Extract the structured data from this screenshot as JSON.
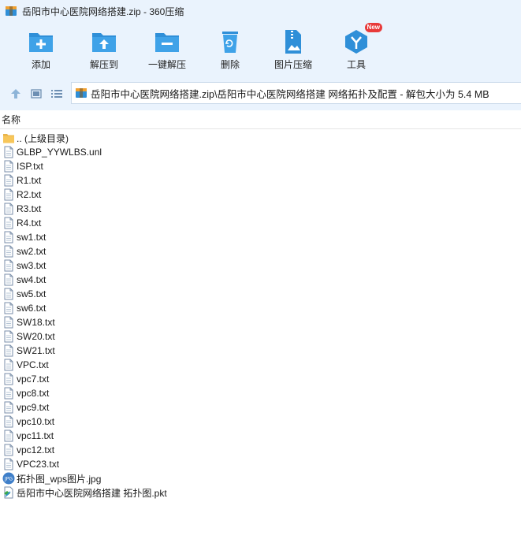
{
  "window": {
    "title": "岳阳市中心医院网络搭建.zip - 360压缩"
  },
  "toolbar": {
    "add_label": "添加",
    "extract_to_label": "解压到",
    "one_click_extract_label": "一键解压",
    "delete_label": "删除",
    "image_compress_label": "图片压缩",
    "tools_label": "工具",
    "tools_badge": "New"
  },
  "address": {
    "path": "岳阳市中心医院网络搭建.zip\\岳阳市中心医院网络搭建 网络拓扑及配置 - 解包大小为 5.4 MB"
  },
  "columns": {
    "name": "名称"
  },
  "files": [
    {
      "name": ".. (上级目录)",
      "type": "folder"
    },
    {
      "name": "GLBP_YYWLBS.unl",
      "type": "doc"
    },
    {
      "name": "ISP.txt",
      "type": "doc"
    },
    {
      "name": "R1.txt",
      "type": "doc"
    },
    {
      "name": "R2.txt",
      "type": "doc"
    },
    {
      "name": "R3.txt",
      "type": "doc"
    },
    {
      "name": "R4.txt",
      "type": "doc"
    },
    {
      "name": "sw1.txt",
      "type": "doc"
    },
    {
      "name": "sw2.txt",
      "type": "doc"
    },
    {
      "name": "sw3.txt",
      "type": "doc"
    },
    {
      "name": "sw4.txt",
      "type": "doc"
    },
    {
      "name": "sw5.txt",
      "type": "doc"
    },
    {
      "name": "sw6.txt",
      "type": "doc"
    },
    {
      "name": "SW18.txt",
      "type": "doc"
    },
    {
      "name": "SW20.txt",
      "type": "doc"
    },
    {
      "name": "SW21.txt",
      "type": "doc"
    },
    {
      "name": "VPC.txt",
      "type": "doc"
    },
    {
      "name": "vpc7.txt",
      "type": "doc"
    },
    {
      "name": "vpc8.txt",
      "type": "doc"
    },
    {
      "name": "vpc9.txt",
      "type": "doc"
    },
    {
      "name": "vpc10.txt",
      "type": "doc"
    },
    {
      "name": "vpc11.txt",
      "type": "doc"
    },
    {
      "name": "vpc12.txt",
      "type": "doc"
    },
    {
      "name": "VPC23.txt",
      "type": "doc"
    },
    {
      "name": "拓扑图_wps图片.jpg",
      "type": "jpg"
    },
    {
      "name": "岳阳市中心医院网络搭建 拓扑图.pkt",
      "type": "pkt"
    }
  ],
  "colors": {
    "chrome_bg": "#eaf3fd",
    "icon_blue": "#2f8fd8",
    "folder_yellow": "#f7c65a",
    "badge_red": "#e83a3a"
  }
}
